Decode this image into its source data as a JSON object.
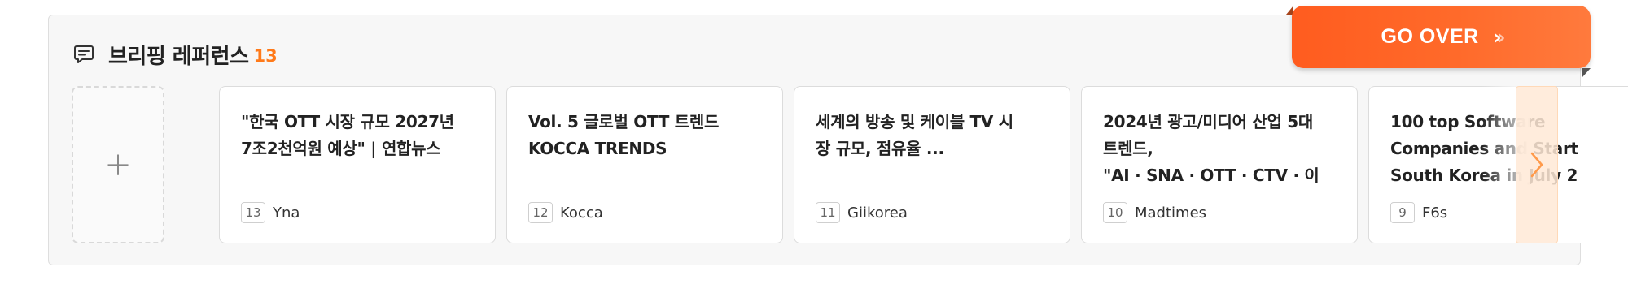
{
  "header": {
    "title": "브리핑 레퍼런스",
    "count": "13"
  },
  "go_over": {
    "label": "GO OVER",
    "chevrons": "›",
    "chevrons_faded": "›"
  },
  "add_card": {
    "plus": "+"
  },
  "cards": [
    {
      "title_lines": [
        "\"한국 OTT 시장 규모 2027년",
        "7조2천억원 예상\" | 연합뉴스"
      ],
      "badge": "13",
      "source": "Yna"
    },
    {
      "title_lines": [
        "Vol. 5 글로벌 OTT 트렌드",
        "KOCCA TRENDS"
      ],
      "badge": "12",
      "source": "Kocca"
    },
    {
      "title_lines": [
        "세계의 방송 및 케이블 TV 시",
        "장 규모, 점유율 ..."
      ],
      "badge": "11",
      "source": "Giikorea"
    },
    {
      "title_lines": [
        "2024년 광고/미디어 산업 5대",
        "트렌드,",
        "\"AI · SNA · OTT · CTV · 이커..."
      ],
      "badge": "10",
      "source": "Madtimes"
    },
    {
      "title_lines": [
        "100 top Software",
        "Companies and Start",
        "South Korea in July 2"
      ],
      "badge": "9",
      "source": "F6s"
    }
  ],
  "colors": {
    "accent": "#ff6a2a",
    "count": "#ff7a1a"
  },
  "icons": {
    "header": "chat-bubble-icon",
    "add": "plus-icon",
    "next": "chevron-right-icon"
  }
}
